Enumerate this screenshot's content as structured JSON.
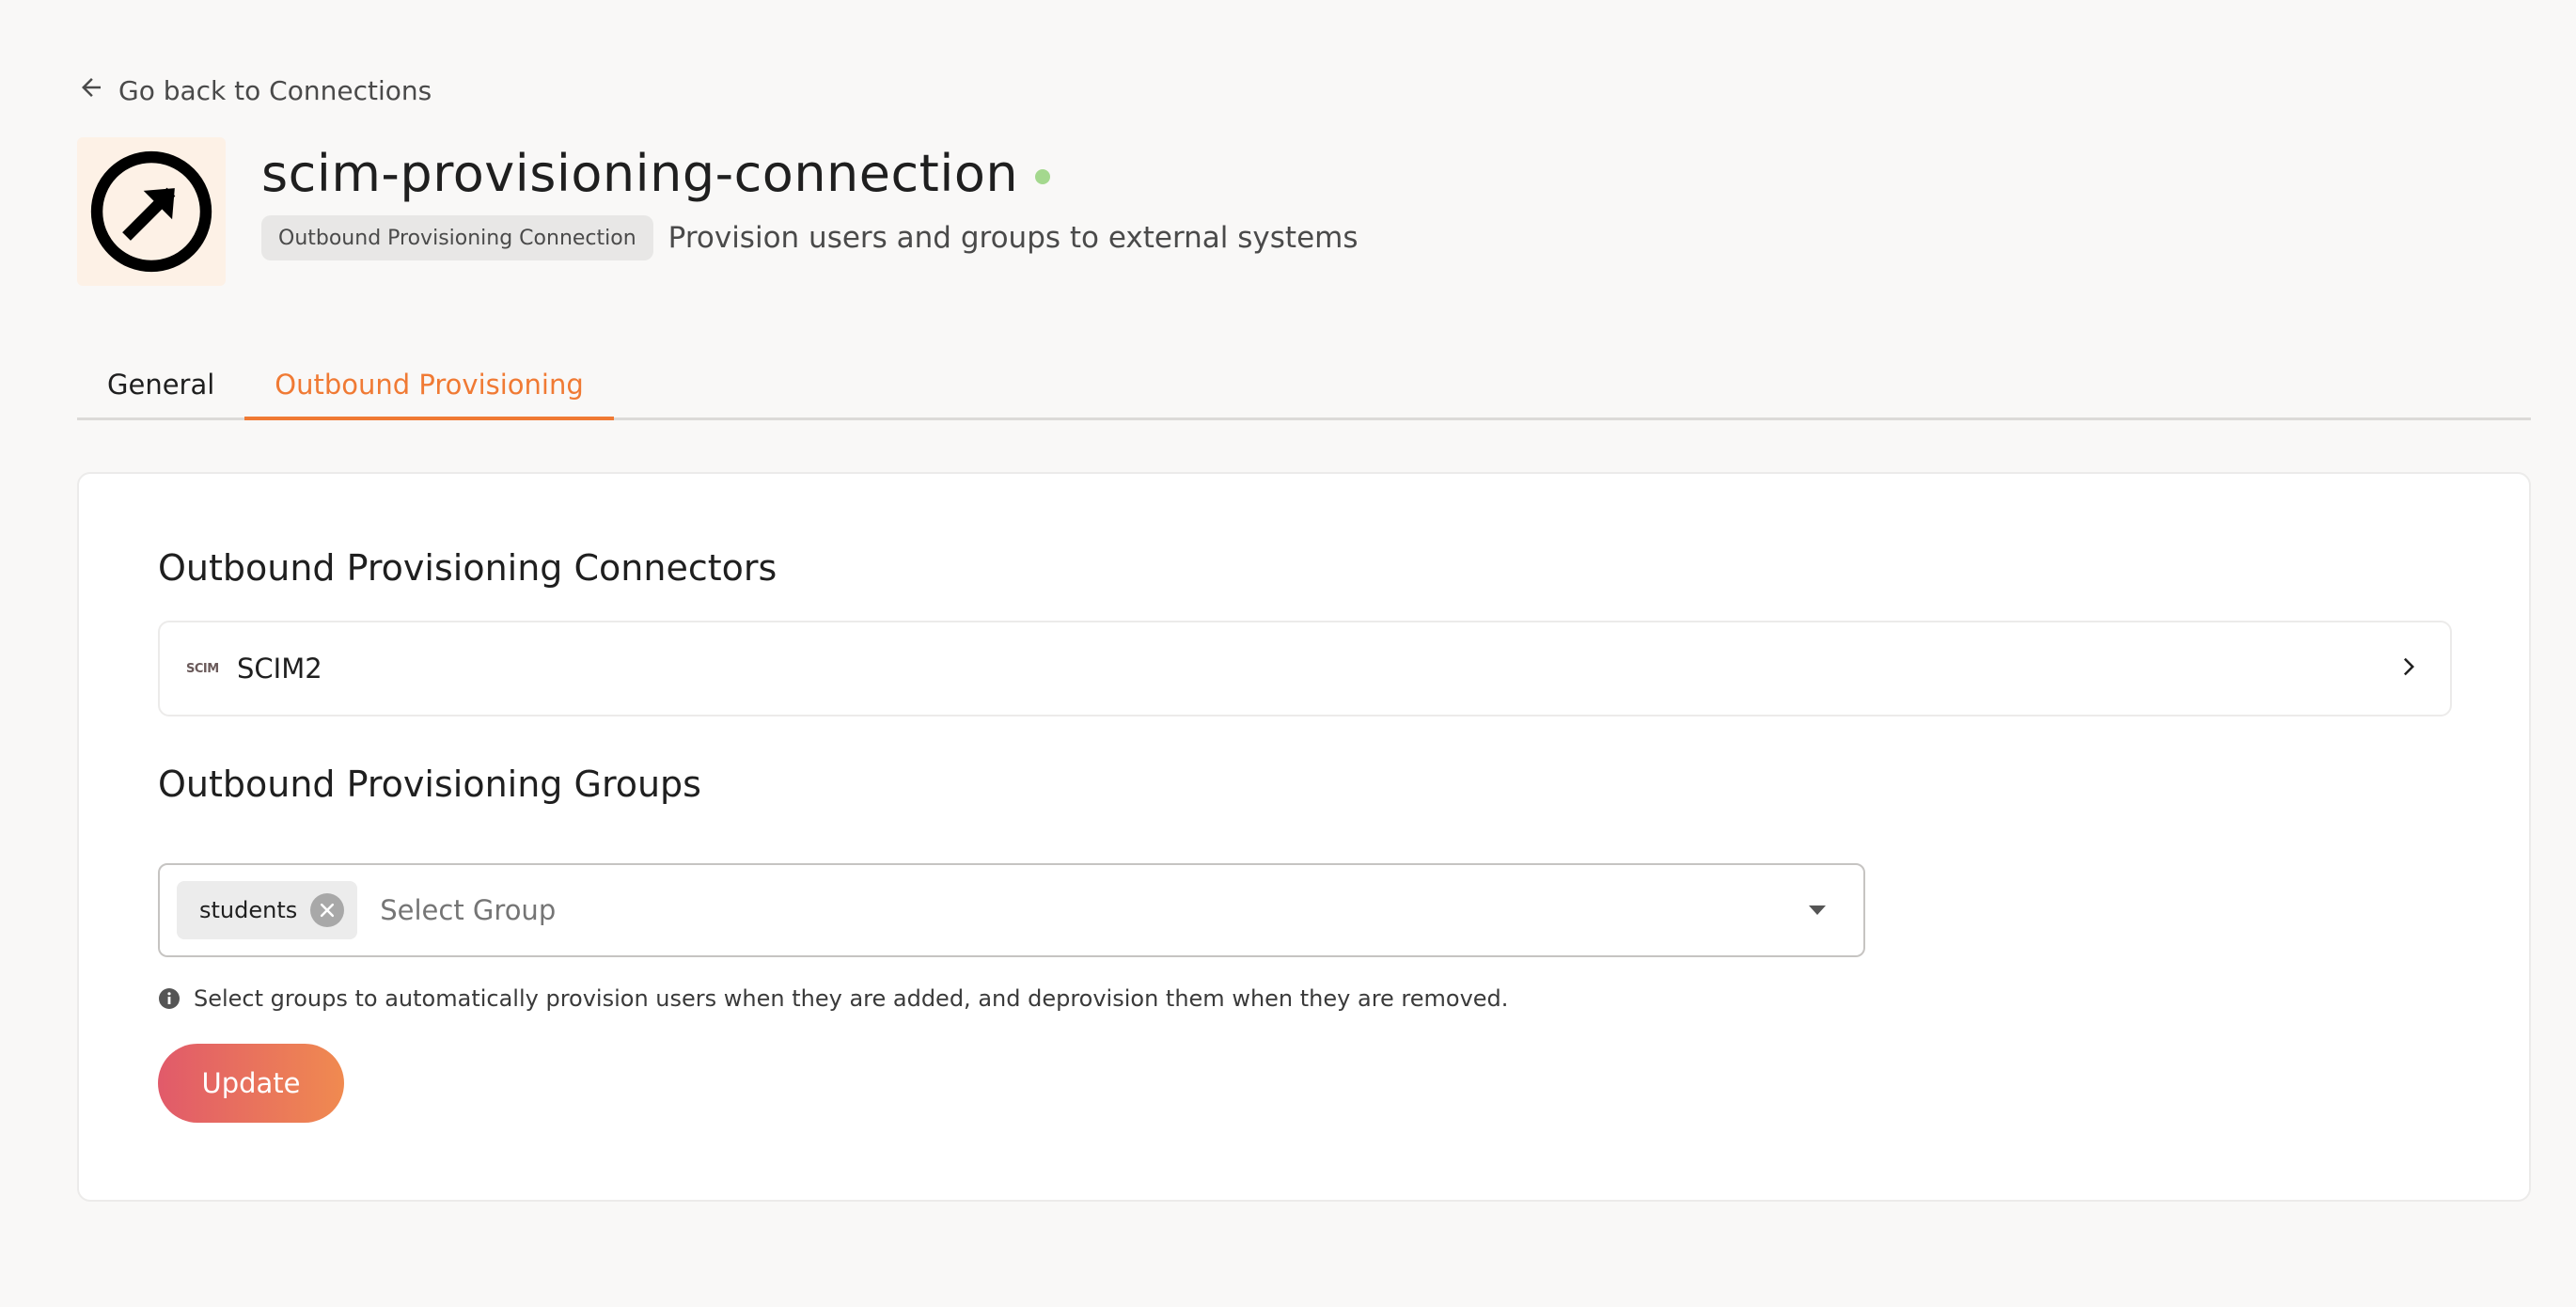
{
  "header": {
    "back_label": "Go back to Connections",
    "connection_name": "scim-provisioning-connection",
    "type_badge": "Outbound Provisioning Connection",
    "description": "Provision users and groups to external systems",
    "status_color": "#a4d88e",
    "logo_icon": "arrow-up-right-circle-icon"
  },
  "tabs": [
    {
      "label": "General",
      "active": false
    },
    {
      "label": "Outbound Provisioning",
      "active": true
    }
  ],
  "connectors_section": {
    "title": "Outbound Provisioning Connectors",
    "items": [
      {
        "icon_text": "SCIM",
        "name": "SCIM2"
      }
    ]
  },
  "groups_section": {
    "title": "Outbound Provisioning Groups",
    "selected_groups": [
      "students"
    ],
    "placeholder": "Select Group",
    "hint": "Select groups to automatically provision users when they are added, and deprovision them when they are removed."
  },
  "actions": {
    "update_label": "Update"
  },
  "colors": {
    "accent": "#f07a34",
    "button_gradient_start": "#e15a6a",
    "button_gradient_end": "#f08a50"
  }
}
